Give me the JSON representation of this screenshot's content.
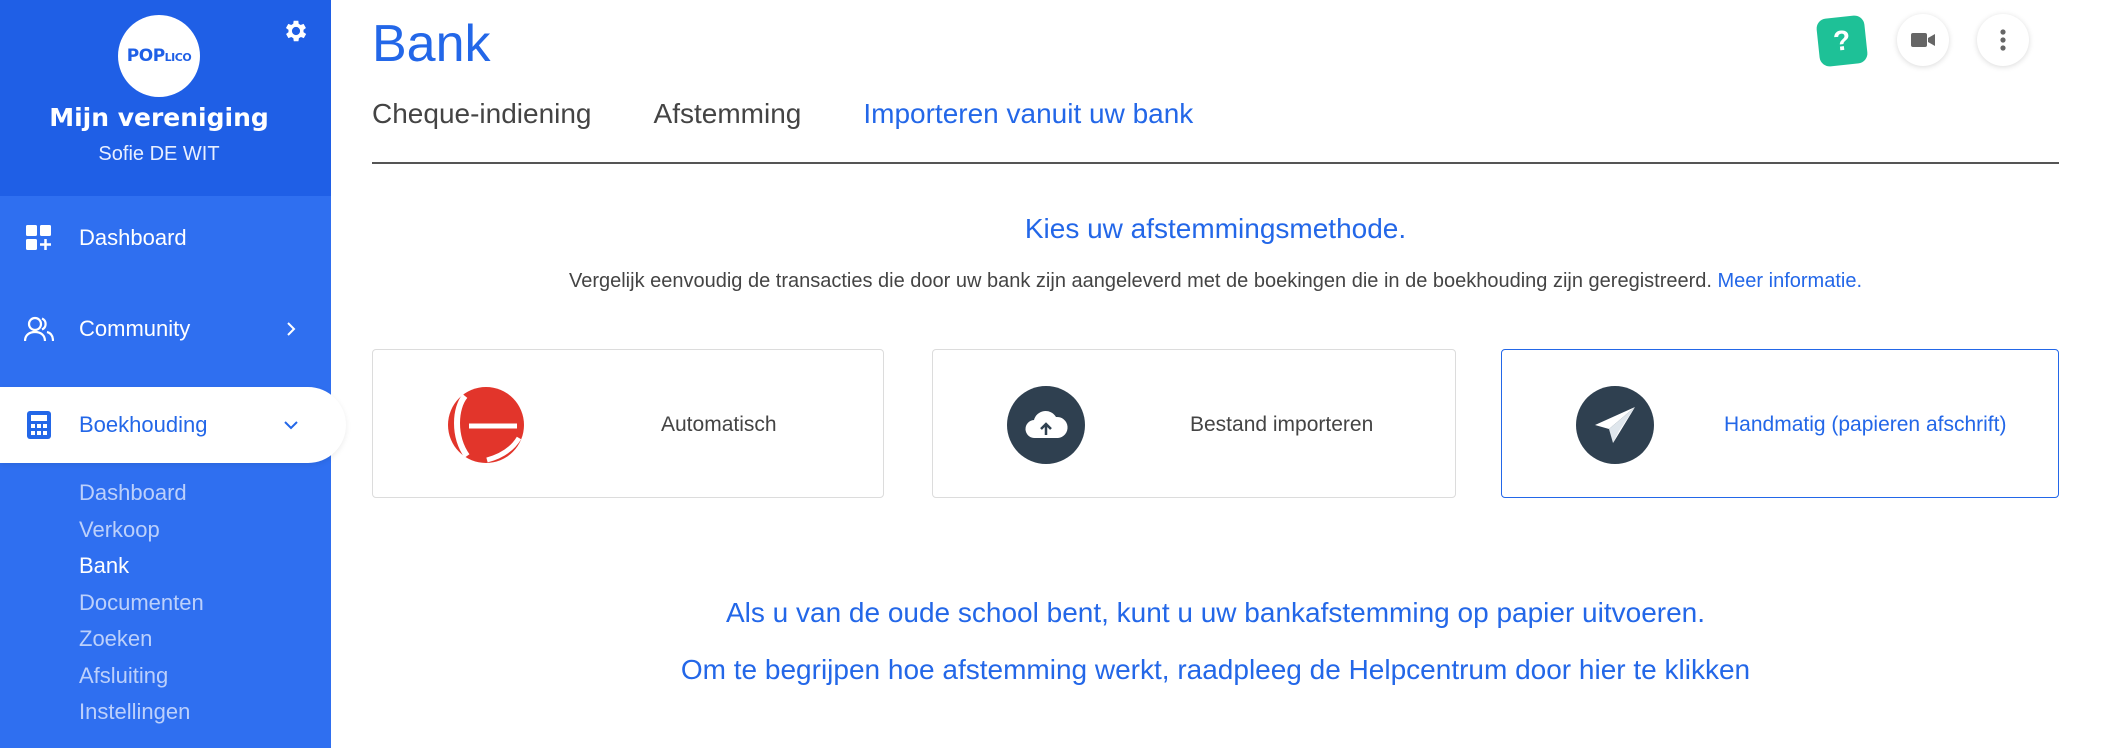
{
  "sidebar": {
    "logo_text": "POPLICO",
    "org_name": "Mijn vereniging",
    "user_name": "Sofie DE WIT",
    "nav": {
      "dashboard": "Dashboard",
      "community": "Community",
      "boekhouding": "Boekhouding"
    },
    "subnav": [
      "Dashboard",
      "Verkoop",
      "Bank",
      "Documenten",
      "Zoeken",
      "Afsluiting",
      "Instellingen"
    ],
    "active_subnav": "Bank",
    "colors": {
      "sidebar": "#2f6ff0",
      "header": "#1f5fe6",
      "accent": "#2367e8"
    }
  },
  "header": {
    "title": "Bank",
    "help_label": "?"
  },
  "tabs": [
    {
      "label": "Cheque-indiening",
      "active": false
    },
    {
      "label": "Afstemming",
      "active": false
    },
    {
      "label": "Importeren vanuit uw bank",
      "active": true
    }
  ],
  "content": {
    "heading": "Kies uw afstemmingsmethode.",
    "description": "Vergelijk eenvoudig de transacties die door uw bank zijn aangeleverd met de boekingen die in de boekhouding zijn geregistreerd.",
    "more_info_link": "Meer informatie.",
    "methods": [
      {
        "label": "Automatisch",
        "icon": "bank-logo-icon",
        "selected": false
      },
      {
        "label": "Bestand importeren",
        "icon": "cloud-upload-icon",
        "selected": false
      },
      {
        "label": "Handmatig (papieren afschrift)",
        "icon": "paper-plane-icon",
        "selected": true
      }
    ],
    "footer_line_1": "Als u van de oude school bent, kunt u uw bankafstemming op papier uitvoeren.",
    "footer_line_2": "Om te begrijpen hoe afstemming werkt, raadpleeg de Helpcentrum door hier te klikken"
  }
}
